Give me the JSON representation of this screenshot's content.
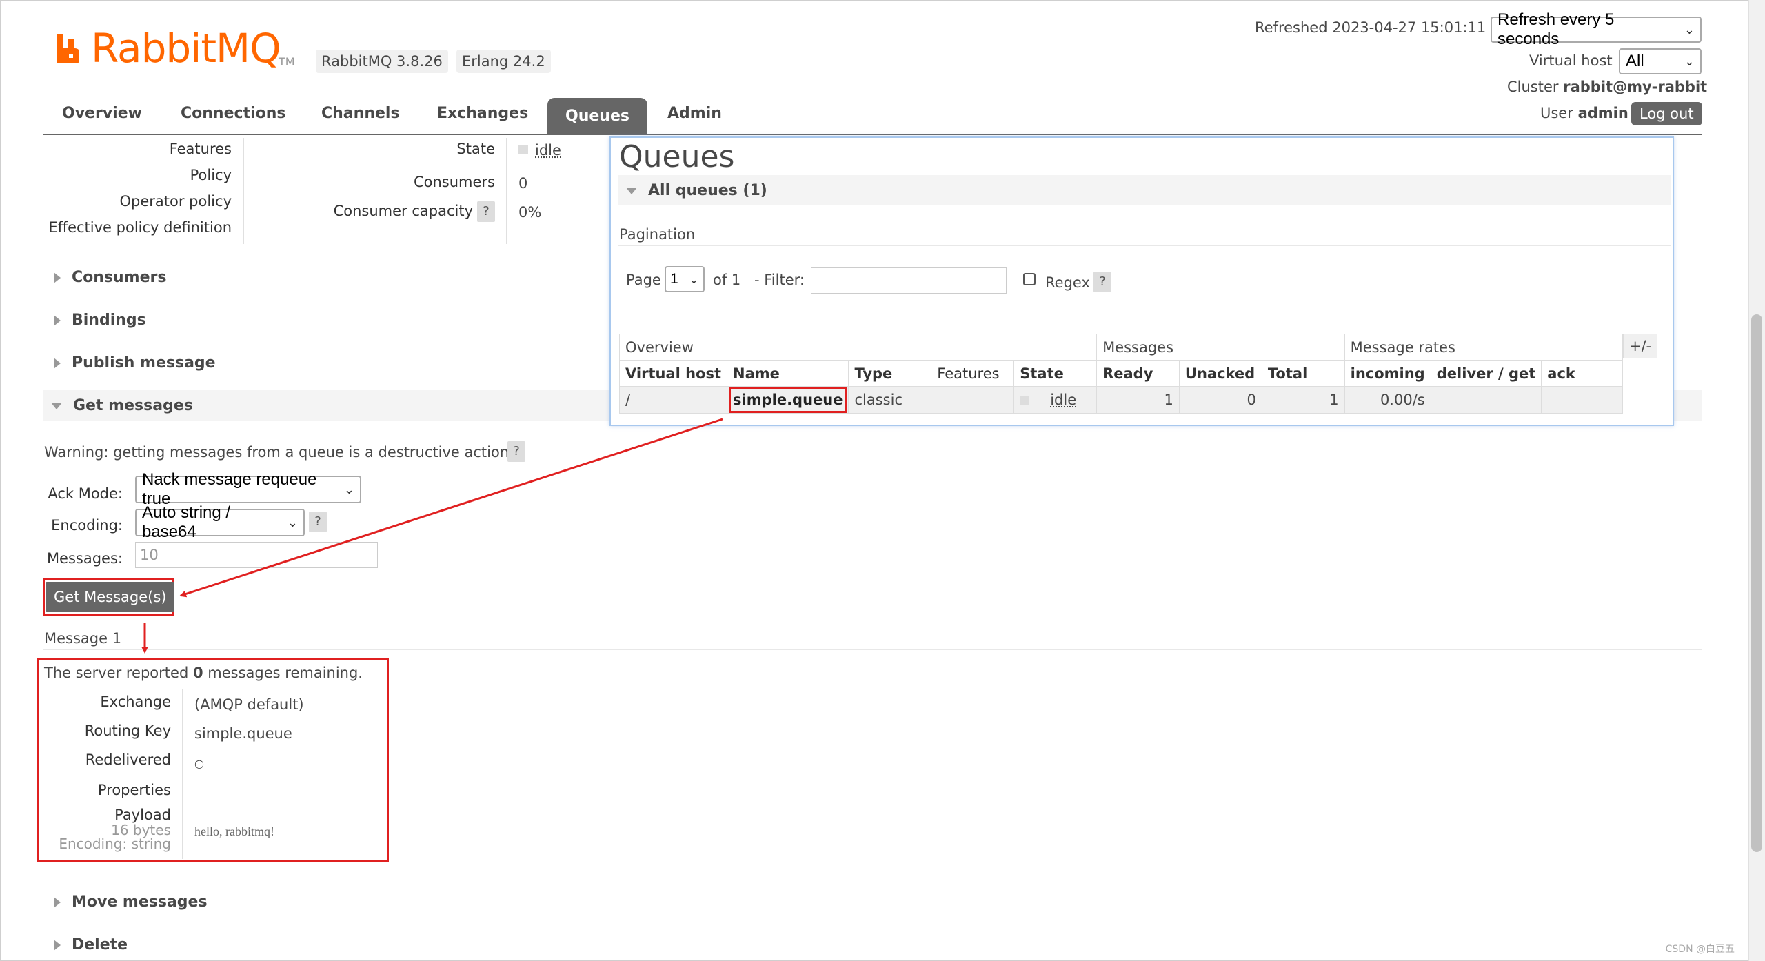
{
  "header": {
    "brand": "RabbitMQ",
    "tm": "TM",
    "version": "RabbitMQ 3.8.26",
    "erlang": "Erlang 24.2",
    "refreshed_label": "Refreshed 2023-04-27 15:01:11",
    "refresh_select": "Refresh every 5 seconds",
    "vhost_label": "Virtual host",
    "vhost_select": "All",
    "cluster_label": "Cluster",
    "cluster_name": "rabbit@my-rabbit",
    "user_label": "User",
    "user_name": "admin",
    "logout": "Log out"
  },
  "tabs": [
    "Overview",
    "Connections",
    "Channels",
    "Exchanges",
    "Queues",
    "Admin"
  ],
  "details_left": {
    "labels": [
      "Features",
      "Policy",
      "Operator policy",
      "Effective policy definition"
    ],
    "state_label": "State",
    "state_value": "idle",
    "consumers_label": "Consumers",
    "consumers_value": "0",
    "capacity_label": "Consumer capacity",
    "capacity_value": "0%",
    "help": "?"
  },
  "sections": {
    "consumers": "Consumers",
    "bindings": "Bindings",
    "publish": "Publish message",
    "get": "Get messages",
    "move": "Move messages",
    "delete": "Delete"
  },
  "get_messages": {
    "warning": "Warning: getting messages from a queue is a destructive action.",
    "ack_label": "Ack Mode:",
    "ack_value": "Nack message requeue true",
    "encoding_label": "Encoding:",
    "encoding_value": "Auto string / base64",
    "messages_label": "Messages:",
    "messages_value": "10",
    "button": "Get Message(s)"
  },
  "message": {
    "heading": "Message 1",
    "server_reported_pre": "The server reported",
    "server_reported_count": "0",
    "server_reported_post": "messages remaining.",
    "exchange_label": "Exchange",
    "exchange_value": "(AMQP default)",
    "routing_label": "Routing Key",
    "routing_value": "simple.queue",
    "redelivered_label": "Redelivered",
    "redelivered_value": "○",
    "properties_label": "Properties",
    "payload_label": "Payload",
    "payload_size": "16 bytes",
    "payload_encoding": "Encoding: string",
    "payload_value": "hello, rabbitmq!"
  },
  "queues_panel": {
    "title": "Queues",
    "all_queues": "All queues (1)",
    "pagination": "Pagination",
    "page_label": "Page",
    "page_value": "1",
    "of_label": "of 1",
    "filter_label": "- Filter:",
    "regex_label": "Regex",
    "help": "?",
    "plusminus": "+/-",
    "group_headers": [
      "Overview",
      "Messages",
      "Message rates"
    ],
    "columns": [
      "Virtual host",
      "Name",
      "Type",
      "Features",
      "State",
      "Ready",
      "Unacked",
      "Total",
      "incoming",
      "deliver / get",
      "ack"
    ],
    "row": {
      "vhost": "/",
      "name": "simple.queue",
      "type": "classic",
      "features": "",
      "state": "idle",
      "ready": "1",
      "unacked": "0",
      "total": "1",
      "incoming": "0.00/s",
      "deliver_get": "",
      "ack": ""
    }
  },
  "watermark": "CSDN @白豆五",
  "colors": {
    "brand": "#ff6600",
    "tab_active": "#666666",
    "highlight": "#e02020",
    "panel_border": "#a8c8ee"
  }
}
